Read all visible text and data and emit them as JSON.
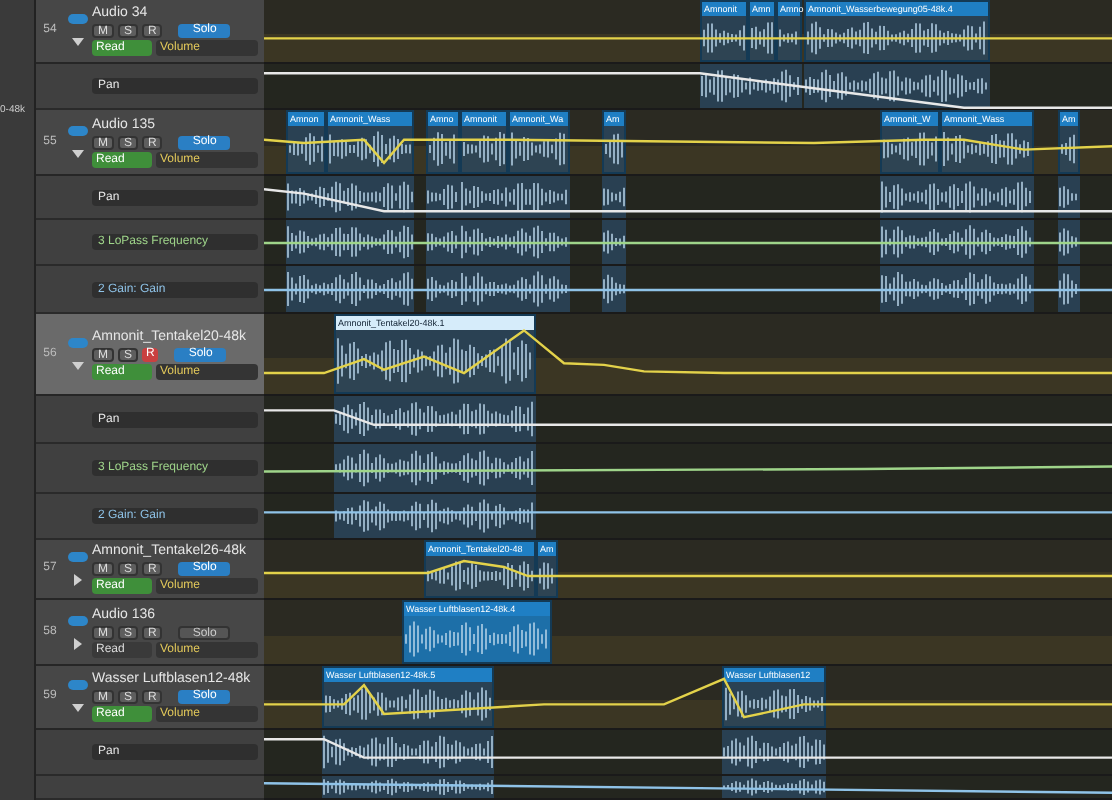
{
  "inspector": {
    "fragment": "0-48k"
  },
  "tracks": [
    {
      "number": "54",
      "name": "Audio 34",
      "selected": false,
      "expanded": true,
      "rec_armed": false,
      "buttons": [
        "M",
        "S",
        "R"
      ],
      "solo": "Solo",
      "solo_on": true,
      "read": "Read",
      "read_active": true,
      "parameter": "Volume",
      "lanes": [
        {
          "parameter": "Pan",
          "color": "#e8e8e8"
        }
      ],
      "regions": [
        {
          "name": "Amnonit",
          "selected": false
        },
        {
          "name": "Amn",
          "selected": false
        },
        {
          "name": "Amno",
          "selected": false
        },
        {
          "name": "Amnonit_Wasserbewegung05-48k.4",
          "selected": false
        }
      ]
    },
    {
      "number": "55",
      "name": "Audio 135",
      "selected": false,
      "expanded": true,
      "rec_armed": false,
      "buttons": [
        "M",
        "S",
        "R"
      ],
      "solo": "Solo",
      "solo_on": true,
      "read": "Read",
      "read_active": true,
      "parameter": "Volume",
      "lanes": [
        {
          "parameter": "Pan",
          "color": "#e8e8e8"
        },
        {
          "parameter": "3 LoPass Frequency",
          "color": "#9fd58a"
        },
        {
          "parameter": "2 Gain: Gain",
          "color": "#8fc3e8"
        }
      ],
      "regions": [
        {
          "name": "Amnon",
          "selected": false
        },
        {
          "name": "Amnonit_Wass",
          "selected": false
        },
        {
          "name": "Amno",
          "selected": false
        },
        {
          "name": "Amnonit",
          "selected": false
        },
        {
          "name": "Amnonit_Wa",
          "selected": false
        },
        {
          "name": "Am",
          "selected": false
        },
        {
          "name": "Amnonit_W",
          "selected": false
        },
        {
          "name": "Amnonit_Wass",
          "selected": false
        },
        {
          "name": "Am",
          "selected": false
        }
      ]
    },
    {
      "number": "56",
      "name": "Amnonit_Tentakel20-48k",
      "selected": true,
      "expanded": true,
      "rec_armed": true,
      "buttons": [
        "M",
        "S",
        "R"
      ],
      "solo": "Solo",
      "solo_on": true,
      "read": "Read",
      "read_active": true,
      "parameter": "Volume",
      "lanes": [
        {
          "parameter": "Pan",
          "color": "#e8e8e8"
        },
        {
          "parameter": "3 LoPass Frequency",
          "color": "#9fd58a"
        },
        {
          "parameter": "2 Gain: Gain",
          "color": "#8fc3e8"
        }
      ],
      "regions": [
        {
          "name": "Amnonit_Tentakel20-48k.1",
          "selected": true
        }
      ]
    },
    {
      "number": "57",
      "name": "Amnonit_Tentakel26-48k",
      "selected": false,
      "expanded": false,
      "rec_armed": false,
      "buttons": [
        "M",
        "S",
        "R"
      ],
      "solo": "Solo",
      "solo_on": true,
      "read": "Read",
      "read_active": true,
      "parameter": "Volume",
      "regions": [
        {
          "name": "Amnonit_Tentakel20-48",
          "selected": false
        },
        {
          "name": "Am",
          "selected": false
        }
      ]
    },
    {
      "number": "58",
      "name": "Audio 136",
      "selected": false,
      "expanded": false,
      "rec_armed": false,
      "buttons": [
        "M",
        "S",
        "R"
      ],
      "solo": "Solo",
      "solo_on": false,
      "read": "Read",
      "read_active": false,
      "parameter": "Volume",
      "regions": [
        {
          "name": "Wasser Luftblasen12-48k.4",
          "selected": false,
          "filled": true
        }
      ]
    },
    {
      "number": "59",
      "name": "Wasser Luftblasen12-48k",
      "selected": false,
      "expanded": true,
      "rec_armed": false,
      "buttons": [
        "M",
        "S",
        "R"
      ],
      "solo": "Solo",
      "solo_on": true,
      "read": "Read",
      "read_active": true,
      "parameter": "Volume",
      "lanes": [
        {
          "parameter": "Pan",
          "color": "#e8e8e8"
        },
        {
          "color": "#8fc3e8"
        }
      ],
      "regions": [
        {
          "name": "Wasser Luftblasen12-48k.5",
          "selected": false
        },
        {
          "name": "Wasser Luftblasen12",
          "selected": false
        }
      ]
    }
  ]
}
